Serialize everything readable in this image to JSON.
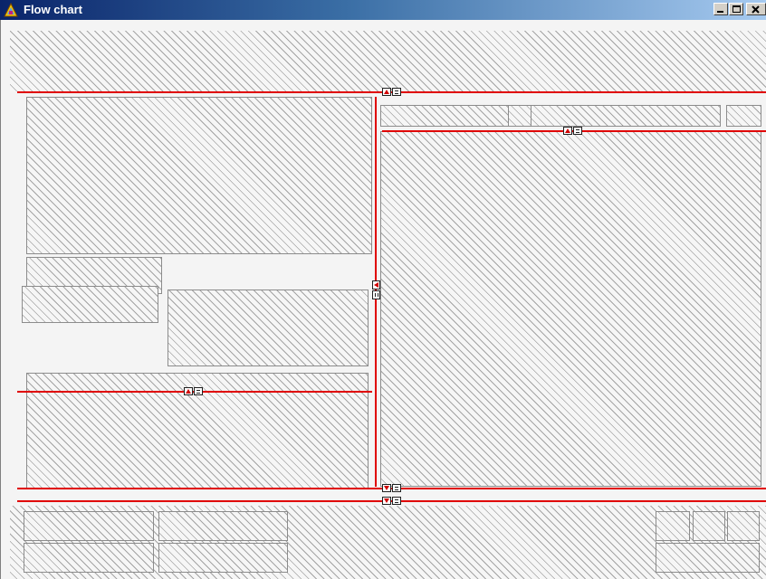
{
  "window": {
    "title": "Flow chart",
    "controls": [
      "minimize",
      "maximize",
      "close"
    ],
    "icons": {
      "app": "flowchart-app-icon",
      "minimize": "minimize-icon",
      "maximize": "maximize-icon",
      "close": "close-icon"
    }
  },
  "splitters": {
    "color": "#e00000",
    "handle_icons": [
      "collapse-up-icon",
      "collapse-left-icon",
      "collapse-down-icon"
    ]
  },
  "panels": {
    "fill": "hatched",
    "hatch_color": "#a4a4a4"
  }
}
